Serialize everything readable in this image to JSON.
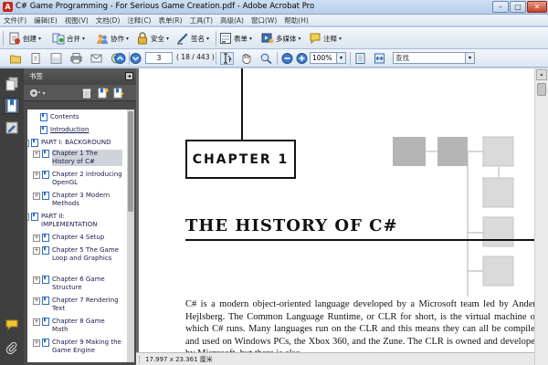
{
  "window": {
    "title": "C# Game Programming - For Serious Game Creation.pdf - Adobe Acrobat Pro",
    "app_icon": "A",
    "minimize": "–",
    "maximize": "□",
    "close": "✕"
  },
  "menu": [
    "文件(F)",
    "编辑(E)",
    "视图(V)",
    "文档(D)",
    "注释(C)",
    "表单(R)",
    "工具(T)",
    "高级(A)",
    "窗口(W)",
    "帮助(H)"
  ],
  "toolbar1": {
    "create": "创建",
    "combine": "合并",
    "collaborate": "协作",
    "secure": "安全",
    "sign": "签名",
    "forms": "表单",
    "multimedia": "多媒体",
    "comment": "注释"
  },
  "toolbar2": {
    "page_current": "3",
    "page_count": "( 18 / 443 )",
    "zoom": "100%",
    "find_placeholder": "查找"
  },
  "bookmarks": {
    "header": "书签",
    "items": [
      {
        "label": "Contents",
        "expander": "",
        "indent": 0
      },
      {
        "label": "Introduction",
        "expander": "",
        "indent": 0
      },
      {
        "label": "PART I: BACKGROUND",
        "expander": "−",
        "indent": 0
      },
      {
        "label": "Chapter 1 The History of C#",
        "expander": "+",
        "indent": 1
      },
      {
        "label": "Chapter 2 Introducing OpenGL",
        "expander": "+",
        "indent": 1
      },
      {
        "label": "Chapter 3 Modern Methods",
        "expander": "+",
        "indent": 1
      },
      {
        "label": "PART II: IMPLEMENTATION",
        "expander": "−",
        "indent": 0
      },
      {
        "label": "Chapter 4 Setup",
        "expander": "+",
        "indent": 1
      },
      {
        "label": "Chapter 5 The Game Loop and Graphics",
        "expander": "+",
        "indent": 1
      },
      {
        "label": "Chapter 6 Game Structure",
        "expander": "+",
        "indent": 1
      },
      {
        "label": "Chapter 7 Rendering Text",
        "expander": "+",
        "indent": 1
      },
      {
        "label": "Chapter 8 Game Math",
        "expander": "+",
        "indent": 1
      },
      {
        "label": "Chapter 9 Making the Game Engine",
        "expander": "+",
        "indent": 1
      }
    ]
  },
  "document": {
    "chapter_label": "CHAPTER 1",
    "chapter_title": "THE HISTORY OF C#",
    "body": "C# is a modern object-oriented language developed by a Microsoft team led by Anders Hejlsberg. The Common Language Runtime, or CLR for short, is the virtual machine on which C# runs. Many languages run on the CLR and this means they can all be compiled and used on Windows PCs, the Xbox 360, and the Zune. The CLR is owned and developed by Microsoft, but there is also"
  },
  "statusbar": {
    "dimensions": "17.997 x 23.361 厘米"
  },
  "colors": {
    "panel_dark": "#4a4a4a",
    "toolbar_gradient_top": "#f4f7fb",
    "accent_blue": "#2b6cc4",
    "diagram_dark": "#b9b9b9",
    "diagram_light": "#d9d9d9"
  }
}
